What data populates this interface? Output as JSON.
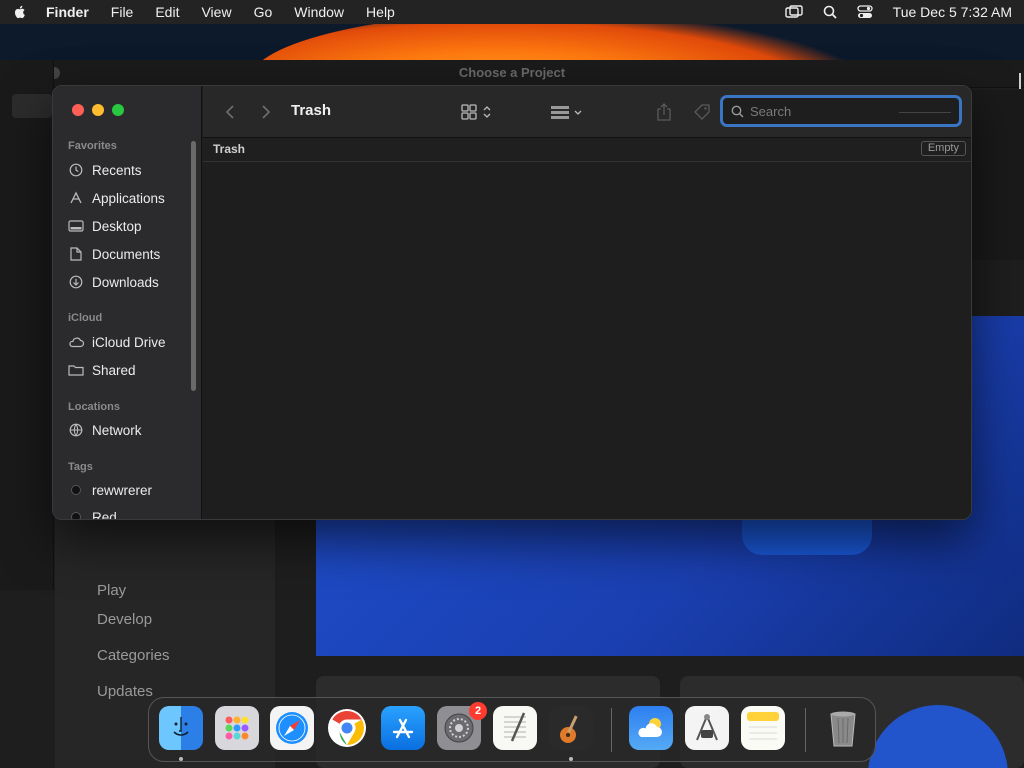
{
  "menubar": {
    "app": "Finder",
    "items": [
      "File",
      "Edit",
      "View",
      "Go",
      "Window",
      "Help"
    ],
    "datetime": "Tue Dec 5  7:32 AM"
  },
  "background_app": {
    "window_title": "Choose a Project",
    "sidebar_items": [
      "Play",
      "Develop",
      "Categories",
      "Updates"
    ]
  },
  "finder": {
    "title": "Trash",
    "search_placeholder": "Search",
    "path_label": "Trash",
    "empty_button": "Empty",
    "sidebar": {
      "favorites_header": "Favorites",
      "favorites": [
        "Recents",
        "Applications",
        "Desktop",
        "Documents",
        "Downloads"
      ],
      "icloud_header": "iCloud",
      "icloud": [
        "iCloud Drive",
        "Shared"
      ],
      "locations_header": "Locations",
      "locations": [
        "Network"
      ],
      "tags_header": "Tags",
      "tags": [
        "rewwrerer",
        "Red"
      ]
    }
  },
  "dock": {
    "apps": [
      "Finder",
      "Launchpad",
      "Safari",
      "Chrome",
      "App Store",
      "System Settings",
      "TextEdit",
      "GarageBand",
      "Weather",
      "Instruments",
      "Notes",
      "Trash"
    ],
    "settings_badge": "2"
  },
  "colors": {
    "accent": "#3a75c4",
    "close": "#ff5f57",
    "minimize": "#febc2e",
    "maximize": "#28c840"
  }
}
